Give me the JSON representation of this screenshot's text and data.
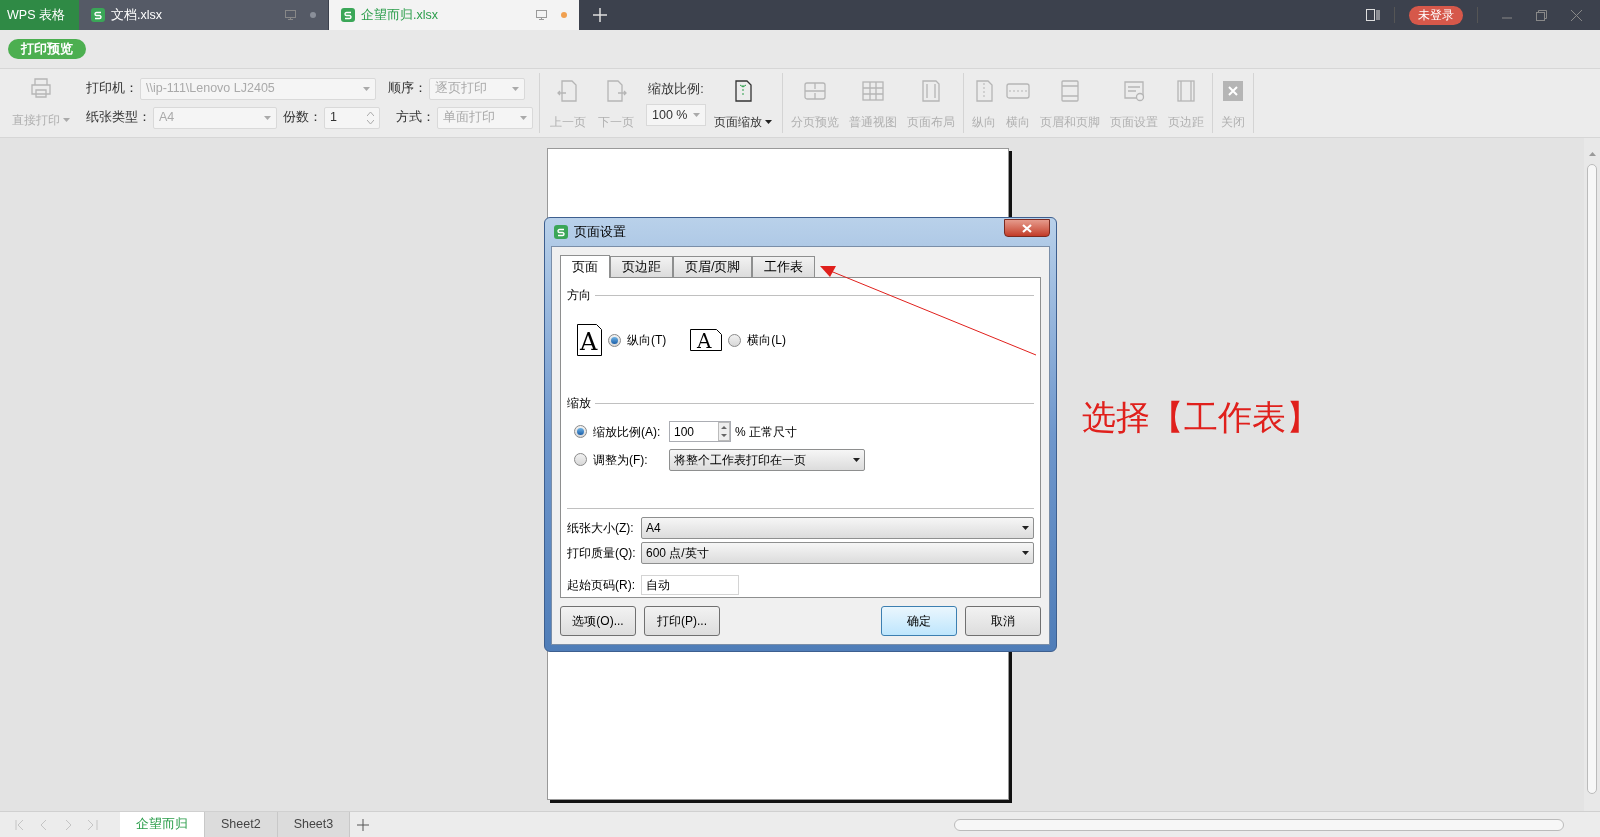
{
  "app_tabs": [
    {
      "label": "WPS 表格",
      "kind": "home",
      "selected": false
    },
    {
      "label": "文档.xlsx",
      "kind": "file",
      "selected": false,
      "modified": false
    },
    {
      "label": "企望而归.xlsx",
      "kind": "file",
      "selected": true,
      "modified": true
    }
  ],
  "account": "未登录",
  "mode_button": "打印预览",
  "toolbar": {
    "direct_print": {
      "label": "直接打印",
      "disabled": true
    },
    "fields": [
      {
        "label": "打印机：",
        "value": "\\\\ip-111\\Lenovo LJ2405",
        "kind": "select",
        "disabled": true
      },
      {
        "label": "顺序：",
        "value": "逐页打印",
        "kind": "select",
        "disabled": true
      },
      {
        "label": "纸张类型：",
        "value": "A4",
        "kind": "select",
        "disabled": true
      },
      {
        "label": "份数：",
        "value": "1",
        "kind": "spin",
        "disabled": false
      },
      {
        "label": "方式：",
        "value": "单面打印",
        "kind": "select",
        "disabled": true
      }
    ],
    "nav": [
      {
        "label": "上一页",
        "kind": "prev",
        "disabled": true
      },
      {
        "label": "下一页",
        "kind": "next",
        "disabled": true
      }
    ],
    "zoom_label": "缩放比例:",
    "zoom_value": "100 %",
    "page_zoom": {
      "label": "页面缩放",
      "disabled": false
    },
    "groups": [
      [
        {
          "label": "分页预览",
          "kind": "split",
          "disabled": true
        },
        {
          "label": "普通视图",
          "kind": "grid",
          "disabled": true
        },
        {
          "label": "页面布局",
          "kind": "layout",
          "disabled": true
        }
      ],
      [
        {
          "label": "纵向",
          "kind": "portrait",
          "disabled": true
        },
        {
          "label": "横向",
          "kind": "landscape",
          "disabled": true
        },
        {
          "label": "页眉和页脚",
          "kind": "header",
          "disabled": true
        },
        {
          "label": "页面设置",
          "kind": "setup",
          "disabled": true
        },
        {
          "label": "页边距",
          "kind": "margin",
          "disabled": true
        }
      ],
      [
        {
          "label": "关闭",
          "kind": "close",
          "disabled": true
        }
      ]
    ]
  },
  "dialog": {
    "title": "页面设置",
    "tabs": [
      {
        "label": "页面",
        "selected": true
      },
      {
        "label": "页边距",
        "selected": false
      },
      {
        "label": "页眉/页脚",
        "selected": false
      },
      {
        "label": "工作表",
        "selected": false
      }
    ],
    "orientation": {
      "label": "方向",
      "options": [
        {
          "label": "纵向(T)",
          "kind": "portrait",
          "selected": true,
          "icon_letter": "A"
        },
        {
          "label": "横向(L)",
          "kind": "landscape",
          "selected": false,
          "icon_letter": "A"
        }
      ]
    },
    "scaling": {
      "label": "缩放",
      "options": [
        {
          "label": "缩放比例(A):",
          "kind": "percent",
          "selected": true,
          "value": "100",
          "suffix": "% 正常尺寸"
        },
        {
          "label": "调整为(F):",
          "kind": "fit",
          "selected": false,
          "value": "将整个工作表打印在一页"
        }
      ]
    },
    "fields": [
      {
        "label": "纸张大小(Z):",
        "value": "A4",
        "kind": "select"
      },
      {
        "label": "打印质量(Q):",
        "value": "600 点/英寸",
        "kind": "select"
      },
      {
        "label": "起始页码(R):",
        "value": "自动",
        "kind": "text"
      }
    ],
    "buttons": [
      {
        "label": "选项(O)...",
        "kind": "left",
        "default": false
      },
      {
        "label": "打印(P)...",
        "kind": "left",
        "default": false
      },
      {
        "label": "确定",
        "kind": "right",
        "default": true
      },
      {
        "label": "取消",
        "kind": "right",
        "default": false
      }
    ]
  },
  "sheet_tabs": [
    {
      "label": "企望而归",
      "selected": true
    },
    {
      "label": "Sheet2",
      "selected": false
    },
    {
      "label": "Sheet3",
      "selected": false
    }
  ],
  "annotation": {
    "text": "选择【工作表】"
  }
}
